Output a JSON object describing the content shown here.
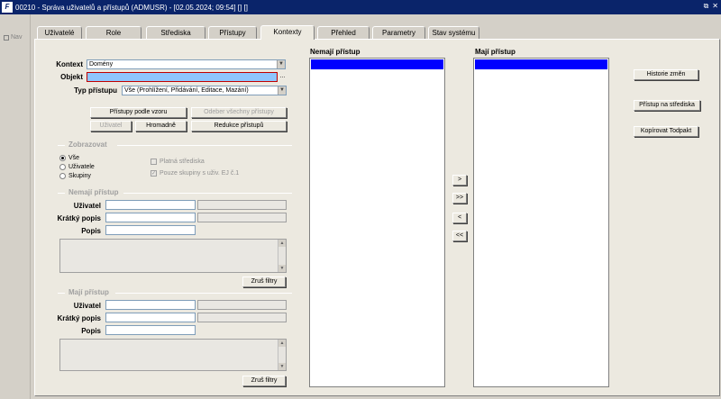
{
  "window": {
    "title": "00210 - Správa uživatelů a přístupů (ADMUSR) - [02.05.2024; 09:54] [] []",
    "icon_label": "F",
    "controls": [
      "⧉",
      "✕"
    ]
  },
  "nav": {
    "label": "Nav"
  },
  "tabs": [
    {
      "label": "Uživatelé",
      "active": false
    },
    {
      "label": "Role",
      "active": false
    },
    {
      "label": "Střediska",
      "active": false
    },
    {
      "label": "Přístupy",
      "active": false
    },
    {
      "label": "Kontexty",
      "active": true
    },
    {
      "label": "Přehled",
      "active": false
    },
    {
      "label": "Parametry",
      "active": false
    },
    {
      "label": "Stav systému",
      "active": false
    }
  ],
  "form": {
    "kontext_label": "Kontext",
    "kontext_value": "Domény",
    "objekt_label": "Objekt",
    "objekt_value": "",
    "objekt_lov": "...",
    "typ_label": "Typ přístupu",
    "typ_value": "Vše (Prohlížení, Přidávání, Editace, Mazání)"
  },
  "buttons": {
    "pristupy_podle_vzoru": "Přístupy podle vzoru",
    "odeber_vsechny": "Odeber všechny přístupy",
    "uzivatel": "Uživatel",
    "hromadne": "Hromadně",
    "redukce": "Redukce přístupů",
    "historie": "Historie změn",
    "pristup_na_strediska": "Přístup na střediska",
    "kopirovat": "Kopírovat Todpakt",
    "zrus_filtry_1": "Zruš filtry",
    "zrus_filtry_2": "Zruš filtry"
  },
  "zobrazovat": {
    "header": "Zobrazovat",
    "options": [
      {
        "label": "Vše",
        "checked": true
      },
      {
        "label": "Uživatele",
        "checked": false
      },
      {
        "label": "Skupiny",
        "checked": false
      }
    ],
    "checks": [
      {
        "label": "Platná střediska",
        "checked": false
      },
      {
        "label": "Pouze skupiny s uživ. EJ č.1",
        "checked": true
      }
    ]
  },
  "nemaji_filter": {
    "header": "Nemají přístup",
    "uzivatel_label": "Uživatel",
    "kratky_label": "Krátký popis",
    "popis_label": "Popis"
  },
  "maji_filter": {
    "header": "Mají přístup",
    "uzivatel_label": "Uživatel",
    "kratky_label": "Krátký popis",
    "popis_label": "Popis"
  },
  "lists": {
    "nemaji_header": "Nemají přístup",
    "maji_header": "Mají přístup"
  },
  "move_buttons": [
    ">",
    ">>",
    "<",
    "<<"
  ],
  "colors": {
    "titlebar": "#0a246a",
    "selection": "#0000ff",
    "highlight_field": "#8ec6ff"
  }
}
